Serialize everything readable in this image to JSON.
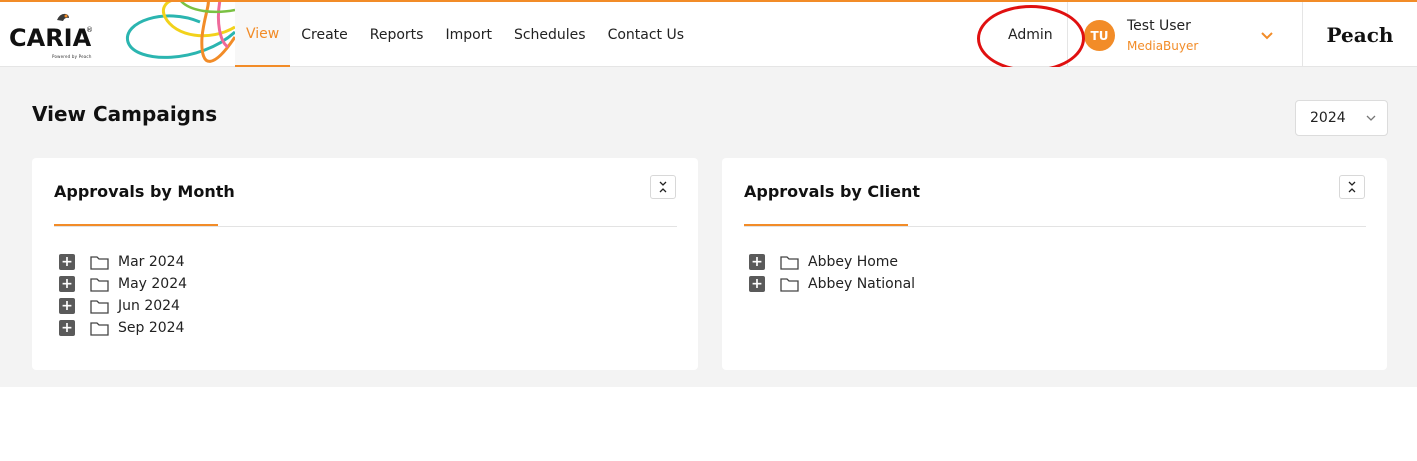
{
  "brand": {
    "logo_text": "CARIA",
    "logo_reg": "®",
    "logo_sub": "Powered by Peach",
    "right_brand": "Peach"
  },
  "nav": {
    "items": [
      {
        "label": "View",
        "active": true
      },
      {
        "label": "Create",
        "active": false
      },
      {
        "label": "Reports",
        "active": false
      },
      {
        "label": "Import",
        "active": false
      },
      {
        "label": "Schedules",
        "active": false
      },
      {
        "label": "Contact Us",
        "active": false
      }
    ],
    "admin_label": "Admin"
  },
  "user": {
    "initials": "TU",
    "name": "Test User",
    "role": "MediaBuyer"
  },
  "page": {
    "title": "View Campaigns",
    "year_selected": "2024"
  },
  "cards": {
    "by_month": {
      "title": "Approvals by Month",
      "items": [
        {
          "label": "Mar 2024"
        },
        {
          "label": "May 2024"
        },
        {
          "label": "Jun 2024"
        },
        {
          "label": "Sep 2024"
        }
      ]
    },
    "by_client": {
      "title": "Approvals by Client",
      "items": [
        {
          "label": "Abbey Home"
        },
        {
          "label": "Abbey National"
        }
      ]
    }
  },
  "colors": {
    "accent": "#f28c28",
    "annotation": "#e01010"
  },
  "icons": {
    "expand": "plus-box-icon",
    "folder": "folder-icon",
    "collapse": "collapse-icon",
    "chevron": "chevron-down-icon"
  }
}
